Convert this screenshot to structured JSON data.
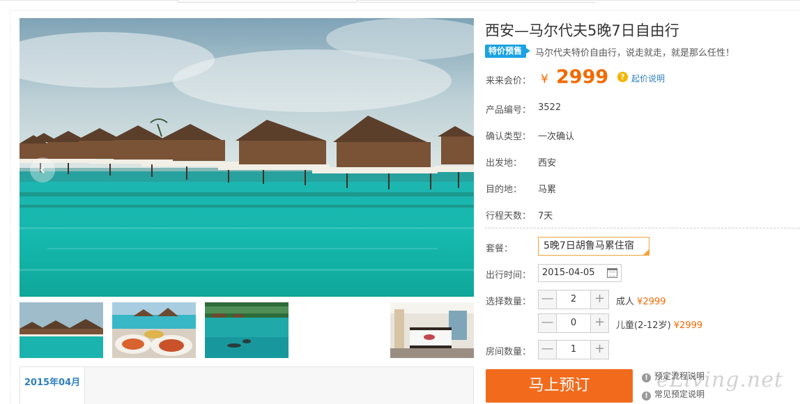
{
  "colors": {
    "accent_orange": "#f26a00",
    "badge_blue": "#1ba2e3",
    "link_blue": "#2e7fc0",
    "book_button": "#f26b1d"
  },
  "gallery": {
    "prev_icon": "chevron-left-icon",
    "prev_glyph": "‹",
    "calendar_tab_label": "2015年04月"
  },
  "product": {
    "title": "西安—马尔代夫5晚7日自由行",
    "badge": "特价预售",
    "subtitle": "马尔代夫特价自由行，说走就走，就是那么任性！",
    "price_label": "来来会价：",
    "currency": "¥",
    "price": "2999",
    "help_glyph": "?",
    "help_link": "起价说明",
    "fields": {
      "code_label": "产品编号：",
      "code": "3522",
      "confirm_label": "确认类型：",
      "confirm": "一次确认",
      "from_label": "出发地：",
      "from": "西安",
      "to_label": "目的地：",
      "to": "马累",
      "days_label": "行程天数：",
      "days": "7天"
    }
  },
  "booking": {
    "package_label": "套餐：",
    "package_value": "5晚7日胡鲁马累住宿",
    "date_label": "出行时间：",
    "date_value": "2015-04-05",
    "qty_label": "选择数量：",
    "minus_glyph": "—",
    "plus_glyph": "+",
    "adults": "2",
    "adult_label": "成人",
    "adult_price": "¥2999",
    "children": "0",
    "child_label": "儿童(2-12岁)",
    "child_price": "¥2999",
    "rooms_label": "房间数量：",
    "rooms": "1",
    "book_button": "马上预订",
    "info_glyph": "!",
    "process_link": "预定流程说明",
    "faq_link": "常见预定说明"
  },
  "watermark": "eLiving.net"
}
